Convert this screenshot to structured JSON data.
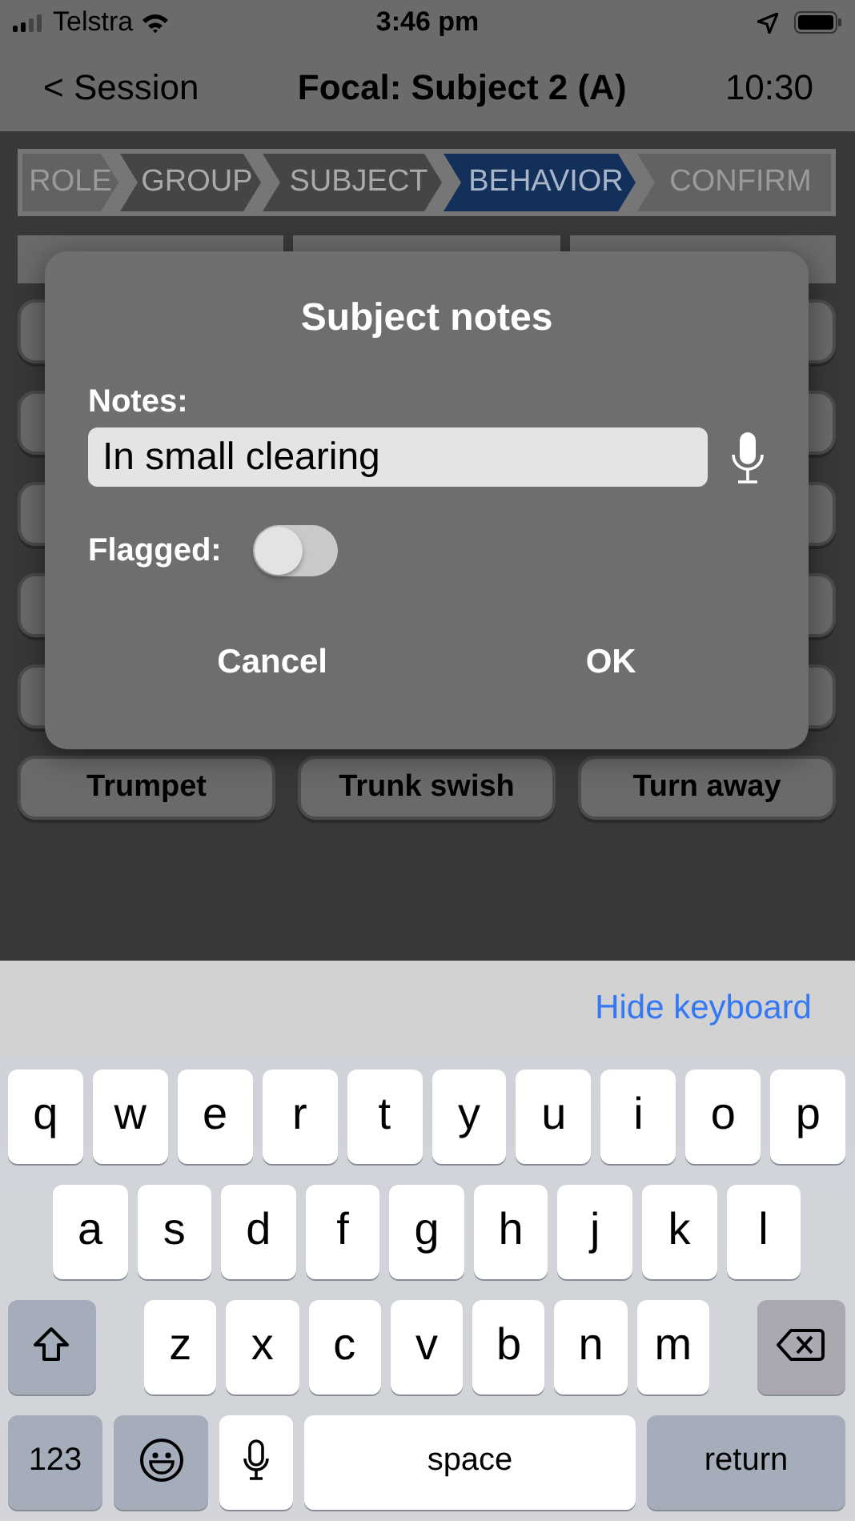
{
  "status_bar": {
    "carrier": "Telstra",
    "time": "3:46 pm"
  },
  "nav": {
    "back": "< Session",
    "title": "Focal: Subject 2 (A)",
    "timer": "10:30"
  },
  "steps": [
    {
      "label": "ROLE",
      "selected": false,
      "disabled": true
    },
    {
      "label": "GROUP",
      "selected": false,
      "disabled": false
    },
    {
      "label": "SUBJECT",
      "selected": false,
      "disabled": false
    },
    {
      "label": "BEHAVIOR",
      "selected": true,
      "disabled": false
    },
    {
      "label": "CONFIRM",
      "selected": false,
      "disabled": true
    }
  ],
  "behaviors": [
    "Trumpet",
    "Trunk swish",
    "Turn away"
  ],
  "dialog": {
    "title": "Subject notes",
    "notes_label": "Notes:",
    "notes_value": "In small clearing",
    "flagged_label": "Flagged:",
    "flagged": {
      "on": false
    },
    "buttons": [
      "Cancel",
      "OK"
    ]
  },
  "keyboard": {
    "accessory": "Hide keyboard",
    "rows": [
      {
        "keys": [
          {
            "kind": "letter",
            "label": "q"
          },
          {
            "kind": "letter",
            "label": "w"
          },
          {
            "kind": "letter",
            "label": "e"
          },
          {
            "kind": "letter",
            "label": "r"
          },
          {
            "kind": "letter",
            "label": "t"
          },
          {
            "kind": "letter",
            "label": "y"
          },
          {
            "kind": "letter",
            "label": "u"
          },
          {
            "kind": "letter",
            "label": "i"
          },
          {
            "kind": "letter",
            "label": "o"
          },
          {
            "kind": "letter",
            "label": "p"
          }
        ]
      },
      {
        "keys": [
          {
            "kind": "letter",
            "label": "a"
          },
          {
            "kind": "letter",
            "label": "s"
          },
          {
            "kind": "letter",
            "label": "d"
          },
          {
            "kind": "letter",
            "label": "f"
          },
          {
            "kind": "letter",
            "label": "g"
          },
          {
            "kind": "letter",
            "label": "h"
          },
          {
            "kind": "letter",
            "label": "j"
          },
          {
            "kind": "letter",
            "label": "k"
          },
          {
            "kind": "letter",
            "label": "l"
          }
        ]
      },
      {
        "keys": [
          {
            "kind": "shift"
          },
          {
            "kind": "letter",
            "label": "z"
          },
          {
            "kind": "letter",
            "label": "x"
          },
          {
            "kind": "letter",
            "label": "c"
          },
          {
            "kind": "letter",
            "label": "v"
          },
          {
            "kind": "letter",
            "label": "b"
          },
          {
            "kind": "letter",
            "label": "n"
          },
          {
            "kind": "letter",
            "label": "m"
          },
          {
            "kind": "delete"
          }
        ]
      },
      {
        "keys": [
          {
            "kind": "numbers",
            "label": "123"
          },
          {
            "kind": "emoji"
          },
          {
            "kind": "dictation"
          },
          {
            "kind": "space",
            "label": "space"
          },
          {
            "kind": "return",
            "label": "return"
          }
        ]
      }
    ]
  }
}
